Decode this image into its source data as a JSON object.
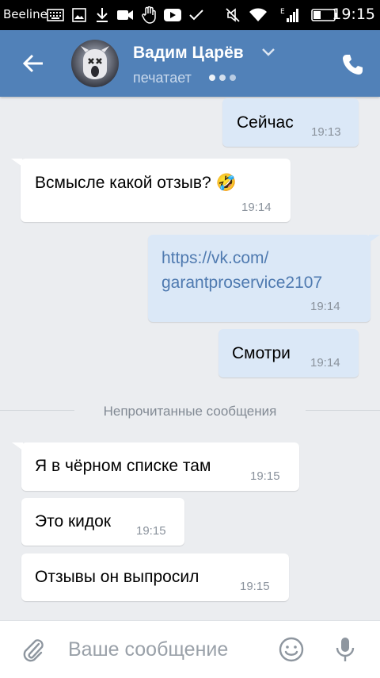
{
  "status_bar": {
    "carrier": "Beeline",
    "time": "19:15",
    "icons": [
      "keyboard-icon",
      "image-icon",
      "download-icon",
      "video-icon",
      "hand-icon",
      "youtube-icon",
      "check-icon",
      "mute-icon",
      "wifi-icon",
      "signal-icon",
      "battery-icon"
    ]
  },
  "header": {
    "contact_name": "Вадим Царёв",
    "status": "печатает",
    "accent_color": "#5181b8"
  },
  "messages": [
    {
      "direction": "out",
      "text": "Сейчас",
      "time": "19:13"
    },
    {
      "direction": "in",
      "text": "Всмысле какой отзыв?",
      "emoji": "🤣",
      "time": "19:14"
    },
    {
      "direction": "out",
      "text_line1": "https://vk.com/",
      "text_line2": "garantproservice2107",
      "time": "19:14"
    },
    {
      "direction": "out",
      "text": "Смотри",
      "time": "19:14"
    },
    {
      "direction": "in",
      "text": "Я в чёрном списке там",
      "time": "19:15"
    },
    {
      "direction": "in",
      "text": "Это кидок",
      "time": "19:15"
    },
    {
      "direction": "in",
      "text": "Отзывы он выпросил",
      "time": "19:15"
    }
  ],
  "divider": {
    "label": "Непрочитанные сообщения"
  },
  "composer": {
    "placeholder": "Ваше сообщение"
  }
}
